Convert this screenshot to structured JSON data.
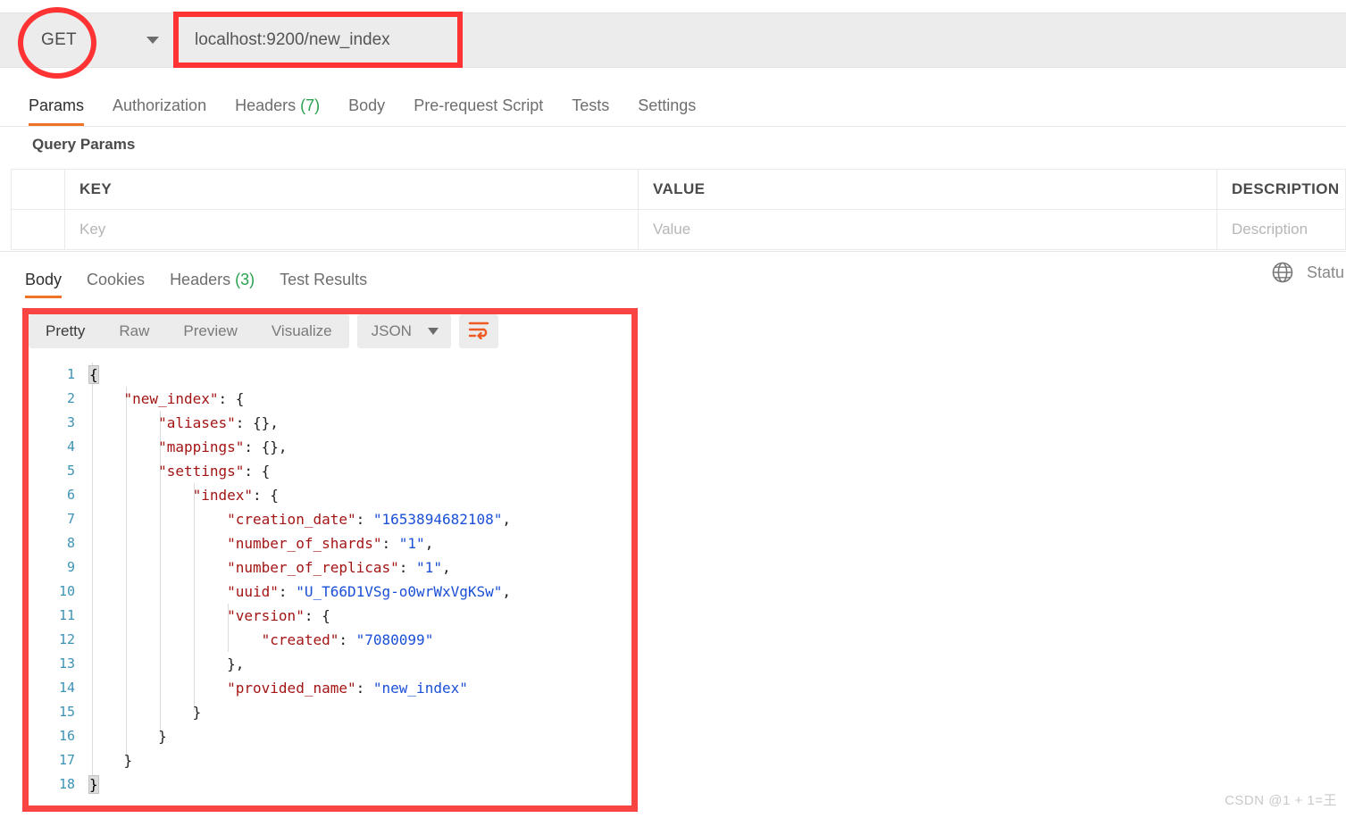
{
  "request_bar": {
    "method": "GET",
    "url_value": "localhost:9200/new_index",
    "method_caret_icon": "chevron-down-icon"
  },
  "request_tabs": [
    {
      "label": "Params",
      "active": true,
      "count": ""
    },
    {
      "label": "Authorization",
      "active": false,
      "count": ""
    },
    {
      "label": "Headers",
      "active": false,
      "count": "(7)"
    },
    {
      "label": "Body",
      "active": false,
      "count": ""
    },
    {
      "label": "Pre-request Script",
      "active": false,
      "count": ""
    },
    {
      "label": "Tests",
      "active": false,
      "count": ""
    },
    {
      "label": "Settings",
      "active": false,
      "count": ""
    }
  ],
  "query_params": {
    "section_title": "Query Params",
    "headers": {
      "key": "KEY",
      "value": "VALUE",
      "description": "DESCRIPTION"
    },
    "row": {
      "key_placeholder": "Key",
      "value_placeholder": "Value",
      "description_placeholder": "Description"
    }
  },
  "response_tabs": [
    {
      "label": "Body",
      "active": true,
      "count": ""
    },
    {
      "label": "Cookies",
      "active": false,
      "count": ""
    },
    {
      "label": "Headers",
      "active": false,
      "count": "(3)"
    },
    {
      "label": "Test Results",
      "active": false,
      "count": ""
    }
  ],
  "response_meta": {
    "globe_icon": "globe-icon",
    "status_text": "Statu"
  },
  "viewer": {
    "modes": [
      {
        "label": "Pretty",
        "active": true
      },
      {
        "label": "Raw",
        "active": false
      },
      {
        "label": "Preview",
        "active": false
      },
      {
        "label": "Visualize",
        "active": false
      }
    ],
    "format": "JSON",
    "format_caret_icon": "chevron-down-icon",
    "wrap_icon": "wrap-lines-icon"
  },
  "code_lines": [
    {
      "n": "1",
      "segments": [
        {
          "t": "{",
          "c": "brk"
        }
      ]
    },
    {
      "n": "2",
      "segments": [
        {
          "t": "    ",
          "c": "p"
        },
        {
          "t": "\"new_index\"",
          "c": "k"
        },
        {
          "t": ": {",
          "c": "p"
        }
      ]
    },
    {
      "n": "3",
      "segments": [
        {
          "t": "        ",
          "c": "p"
        },
        {
          "t": "\"aliases\"",
          "c": "k"
        },
        {
          "t": ": {},",
          "c": "p"
        }
      ]
    },
    {
      "n": "4",
      "segments": [
        {
          "t": "        ",
          "c": "p"
        },
        {
          "t": "\"mappings\"",
          "c": "k"
        },
        {
          "t": ": {},",
          "c": "p"
        }
      ]
    },
    {
      "n": "5",
      "segments": [
        {
          "t": "        ",
          "c": "p"
        },
        {
          "t": "\"settings\"",
          "c": "k"
        },
        {
          "t": ": {",
          "c": "p"
        }
      ]
    },
    {
      "n": "6",
      "segments": [
        {
          "t": "            ",
          "c": "p"
        },
        {
          "t": "\"index\"",
          "c": "k"
        },
        {
          "t": ": {",
          "c": "p"
        }
      ]
    },
    {
      "n": "7",
      "segments": [
        {
          "t": "                ",
          "c": "p"
        },
        {
          "t": "\"creation_date\"",
          "c": "k"
        },
        {
          "t": ": ",
          "c": "p"
        },
        {
          "t": "\"1653894682108\"",
          "c": "s"
        },
        {
          "t": ",",
          "c": "p"
        }
      ]
    },
    {
      "n": "8",
      "segments": [
        {
          "t": "                ",
          "c": "p"
        },
        {
          "t": "\"number_of_shards\"",
          "c": "k"
        },
        {
          "t": ": ",
          "c": "p"
        },
        {
          "t": "\"1\"",
          "c": "s"
        },
        {
          "t": ",",
          "c": "p"
        }
      ]
    },
    {
      "n": "9",
      "segments": [
        {
          "t": "                ",
          "c": "p"
        },
        {
          "t": "\"number_of_replicas\"",
          "c": "k"
        },
        {
          "t": ": ",
          "c": "p"
        },
        {
          "t": "\"1\"",
          "c": "s"
        },
        {
          "t": ",",
          "c": "p"
        }
      ]
    },
    {
      "n": "10",
      "segments": [
        {
          "t": "                ",
          "c": "p"
        },
        {
          "t": "\"uuid\"",
          "c": "k"
        },
        {
          "t": ": ",
          "c": "p"
        },
        {
          "t": "\"U_T66D1VSg-o0wrWxVgKSw\"",
          "c": "s"
        },
        {
          "t": ",",
          "c": "p"
        }
      ]
    },
    {
      "n": "11",
      "segments": [
        {
          "t": "                ",
          "c": "p"
        },
        {
          "t": "\"version\"",
          "c": "k"
        },
        {
          "t": ": {",
          "c": "p"
        }
      ]
    },
    {
      "n": "12",
      "segments": [
        {
          "t": "                    ",
          "c": "p"
        },
        {
          "t": "\"created\"",
          "c": "k"
        },
        {
          "t": ": ",
          "c": "p"
        },
        {
          "t": "\"7080099\"",
          "c": "s"
        }
      ]
    },
    {
      "n": "13",
      "segments": [
        {
          "t": "                },",
          "c": "p"
        }
      ]
    },
    {
      "n": "14",
      "segments": [
        {
          "t": "                ",
          "c": "p"
        },
        {
          "t": "\"provided_name\"",
          "c": "k"
        },
        {
          "t": ": ",
          "c": "p"
        },
        {
          "t": "\"new_index\"",
          "c": "s"
        }
      ]
    },
    {
      "n": "15",
      "segments": [
        {
          "t": "            }",
          "c": "p"
        }
      ]
    },
    {
      "n": "16",
      "segments": [
        {
          "t": "        }",
          "c": "p"
        }
      ]
    },
    {
      "n": "17",
      "segments": [
        {
          "t": "    }",
          "c": "p"
        }
      ]
    },
    {
      "n": "18",
      "segments": [
        {
          "t": "}",
          "c": "brk"
        }
      ]
    }
  ],
  "watermark": "CSDN @1 + 1=王",
  "colors": {
    "accent": "#ef7226",
    "annotation_red": "#ff3333",
    "count_green": "#2aa14f",
    "json_key": "#a31515",
    "json_string": "#1a4fd6",
    "line_number": "#3d93b5"
  }
}
